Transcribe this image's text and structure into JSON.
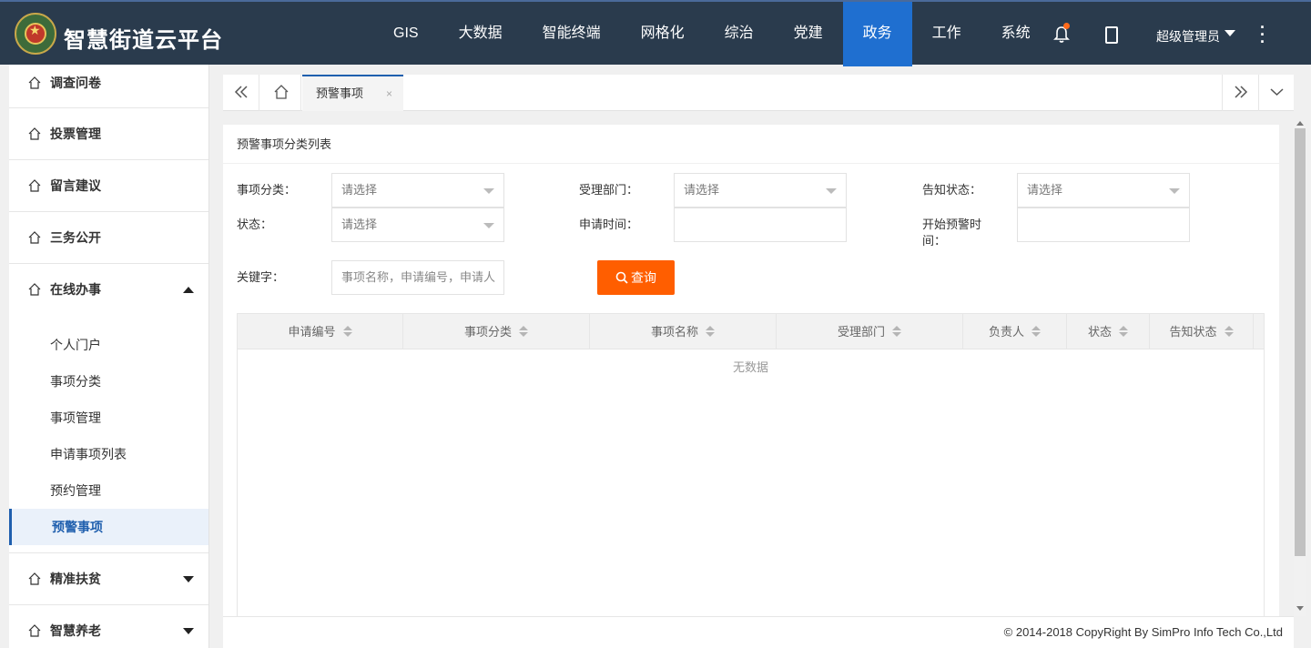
{
  "header": {
    "brand": "智慧街道云平台",
    "nav": [
      {
        "label": "GIS",
        "active": false
      },
      {
        "label": "大数据",
        "active": false
      },
      {
        "label": "智能终端",
        "active": false
      },
      {
        "label": "网格化",
        "active": false
      },
      {
        "label": "综治",
        "active": false
      },
      {
        "label": "党建",
        "active": false
      },
      {
        "label": "政务",
        "active": true
      },
      {
        "label": "工作",
        "active": false
      },
      {
        "label": "系统",
        "active": false
      }
    ],
    "user": "超级管理员",
    "icons": [
      "bell-icon",
      "phone-icon",
      "more-vertical-icon"
    ],
    "active_color": "#1f6fd0",
    "bar_color": "#2a3b4d"
  },
  "sidebar": {
    "items": [
      {
        "label": "调查问卷"
      },
      {
        "label": "投票管理"
      },
      {
        "label": "留言建议"
      },
      {
        "label": "三务公开"
      },
      {
        "label": "在线办事",
        "expanded": true
      }
    ],
    "sub_items": [
      {
        "label": "个人门户"
      },
      {
        "label": "事项分类"
      },
      {
        "label": "事项管理"
      },
      {
        "label": "申请事项列表"
      },
      {
        "label": "预约管理"
      },
      {
        "label": "预警事项",
        "active": true
      }
    ],
    "tail_items": [
      {
        "label": "精准扶贫"
      },
      {
        "label": "智慧养老"
      }
    ]
  },
  "tabs": {
    "active_label": "预警事项",
    "close_symbol": "×"
  },
  "panel": {
    "title": "预警事项分类列表",
    "filters": {
      "category_label": "事项分类：",
      "category_placeholder": "请选择",
      "dept_label": "受理部门：",
      "dept_placeholder": "请选择",
      "notify_label": "告知状态：",
      "notify_placeholder": "请选择",
      "status_label": "状态：",
      "status_placeholder": "请选择",
      "apply_time_label": "申请时间：",
      "warn_time_label_1": "开始预警时",
      "warn_time_label_2": "间：",
      "keyword_label": "关键字：",
      "keyword_placeholder": "事项名称，申请编号，申请人"
    },
    "query_button": "查询",
    "query_color": "#ff5e00",
    "table": {
      "columns": [
        "申请编号",
        "事项分类",
        "事项名称",
        "受理部门",
        "负责人",
        "状态",
        "告知状态"
      ],
      "empty_text": "无数据"
    }
  },
  "footer": {
    "copyright": "© 2014-2018 CopyRight By SimPro Info Tech Co.,Ltd"
  }
}
